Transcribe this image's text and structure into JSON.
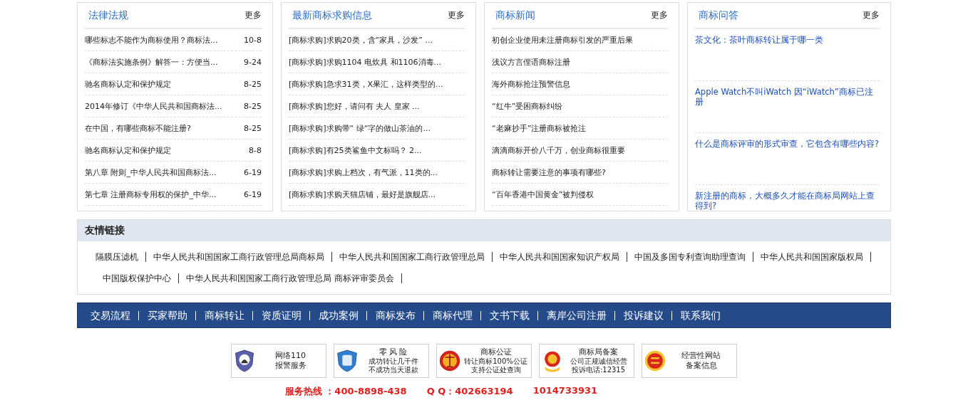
{
  "panels": [
    {
      "kind": "dated",
      "title": "法律法规",
      "more": "更多",
      "items": [
        {
          "text": "哪些标志不能作为商标使用？商标法...",
          "date": "10-8"
        },
        {
          "text": "《商标法实施条例》解答一：方便当...",
          "date": "9-24"
        },
        {
          "text": "驰名商标认定和保护规定",
          "date": "8-25"
        },
        {
          "text": "2014年修订《中华人民共和国商标法...",
          "date": "8-25"
        },
        {
          "text": "在中国，有哪些商标不能注册?",
          "date": "8-25"
        },
        {
          "text": "驰名商标认定和保护规定",
          "date": "8-8"
        },
        {
          "text": "第八章 附则_中华人民共和国商标法...",
          "date": "6-19"
        },
        {
          "text": "第七章 注册商标专用权的保护_中华...",
          "date": "6-19"
        }
      ]
    },
    {
      "kind": "plain",
      "title": "最新商标求购信息",
      "more": "更多",
      "items": [
        {
          "text": "[商标求购]求购20类，含“家具，沙发” ..."
        },
        {
          "text": "[商标求购]求购1104 电炊具 和1106消毒..."
        },
        {
          "text": "[商标求购]急求31类，X果汇，这样类型的..."
        },
        {
          "text": "[商标求购]您好，请问有 夫人 皇家 ..."
        },
        {
          "text": "[商标求购]求购带“ 绿“字的做山茶油的..."
        },
        {
          "text": "[商标求购]有25类鲨鱼中文标吗？ 2..."
        },
        {
          "text": "[商标求购]求购上档次，有气派，11类的..."
        },
        {
          "text": "[商标求购]求购天猫店铺，最好是旗舰店..."
        }
      ]
    },
    {
      "kind": "plain",
      "title": "商标新闻",
      "more": "更多",
      "items": [
        {
          "text": "初创企业使用未注册商标引发的严重后果"
        },
        {
          "text": "浅议方言俚语商标注册"
        },
        {
          "text": "海外商标抢注预警信息"
        },
        {
          "text": "“红牛”受困商标纠纷"
        },
        {
          "text": "“老麻抄手”注册商标被抢注"
        },
        {
          "text": "滴滴商标开价八千万，创业商标很重要"
        },
        {
          "text": "商标转让需要注意的事项有哪些?"
        },
        {
          "text": "“百年香港中国黄金”被判侵权"
        }
      ]
    },
    {
      "kind": "qa",
      "title": "商标问答",
      "more": "更多",
      "items": [
        {
          "text": "茶文化：茶叶商标转让属于哪一类"
        },
        {
          "text": "Apple Watch不叫iWatch 因“iWatch”商标已注册"
        },
        {
          "text": "什么是商标评审的形式审查，它包含有哪些内容?"
        },
        {
          "text": "新注册的商标，大概多久才能在商标局网站上查得到?"
        }
      ]
    }
  ],
  "friend_links": {
    "title": "友情链接",
    "links": [
      "隔膜压滤机",
      "中华人民共和国国家工商行政管理总局商标局",
      "中华人民共和国国家工商行政管理总局",
      "中华人民共和国国家知识产权局",
      "中国及多国专利查询助理查询",
      "中华人民共和国国家版权局",
      "中国版权保护中心",
      "中华人民共和国国家工商行政管理总局 商标评审委员会"
    ]
  },
  "nav": [
    "交易流程",
    "买家帮助",
    "商标转让",
    "资质证明",
    "成功案例",
    "商标发布",
    "商标代理",
    "文书下载",
    "离岸公司注册",
    "投诉建议",
    "联系我们"
  ],
  "badges": [
    {
      "kind": "police",
      "lines": [
        "网络110",
        "报警服务"
      ]
    },
    {
      "kind": "shield",
      "lines": [
        "零 风 险",
        "成功转让几千件",
        "不成功当天退款"
      ]
    },
    {
      "kind": "scales",
      "lines": [
        "商标公证",
        "转让商标100%公证",
        "支持公证处查询"
      ]
    },
    {
      "kind": "emblem",
      "lines": [
        "商标局备案",
        "公司正规诚信经营",
        "投诉电话:12315"
      ]
    },
    {
      "kind": "seal",
      "lines": [
        "经营性网站",
        "备案信息"
      ]
    }
  ],
  "hotline": {
    "phone": "服务热线 ：400-8898-438",
    "qq": "Q Q：402663194",
    "qq2": "1014733931"
  }
}
